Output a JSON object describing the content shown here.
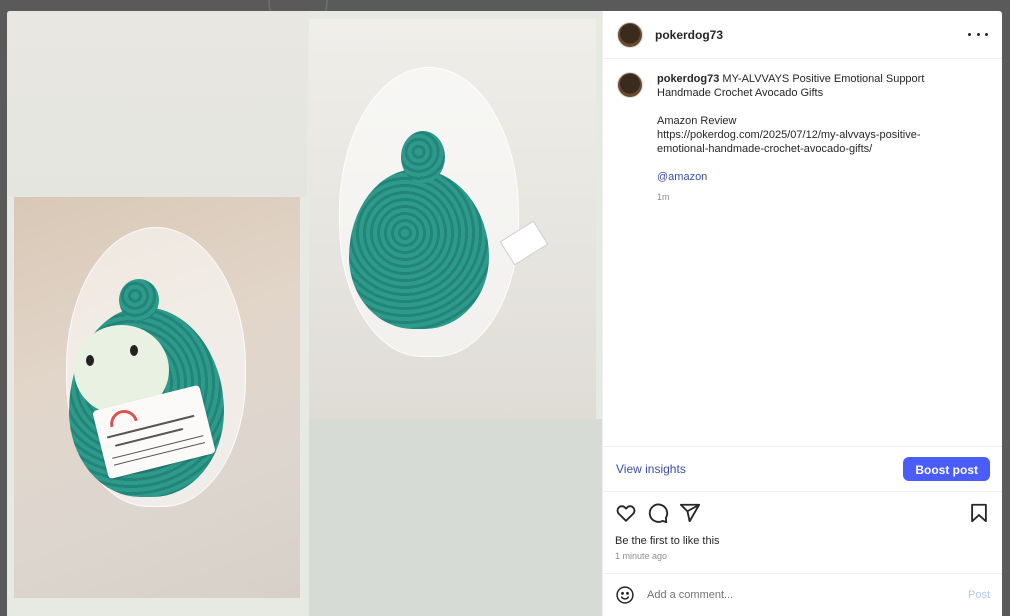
{
  "post": {
    "username": "pokerdog73",
    "caption_title_line1": "MY-ALVVAYS Positive Emotional Support",
    "caption_title_line2": "Handmade Crochet Avocado Gifts",
    "review_label": "Amazon Review",
    "review_url_line1": "https://pokerdog.com/2025/07/12/my-alvvays-positive-",
    "review_url_line2": "emotional-handmade-crochet-avocado-gifts/",
    "mention": "@amazon",
    "caption_time": "1m"
  },
  "insights": {
    "view_label": "View insights",
    "boost_label": "Boost post"
  },
  "engagement": {
    "likes_text": "Be the first to like this",
    "time_ago": "1 minute ago"
  },
  "comment": {
    "placeholder": "Add a comment...",
    "post_label": "Post"
  },
  "icons": {
    "more": "more-options-icon",
    "like": "heart-icon",
    "comment": "comment-bubble-icon",
    "share": "send-paper-plane-icon",
    "save": "bookmark-icon",
    "emoji": "emoji-smiley-icon"
  },
  "colors": {
    "link": "#3b4ea8",
    "boost_button": "#4a5df9",
    "post_disabled": "#b3c5f5"
  }
}
